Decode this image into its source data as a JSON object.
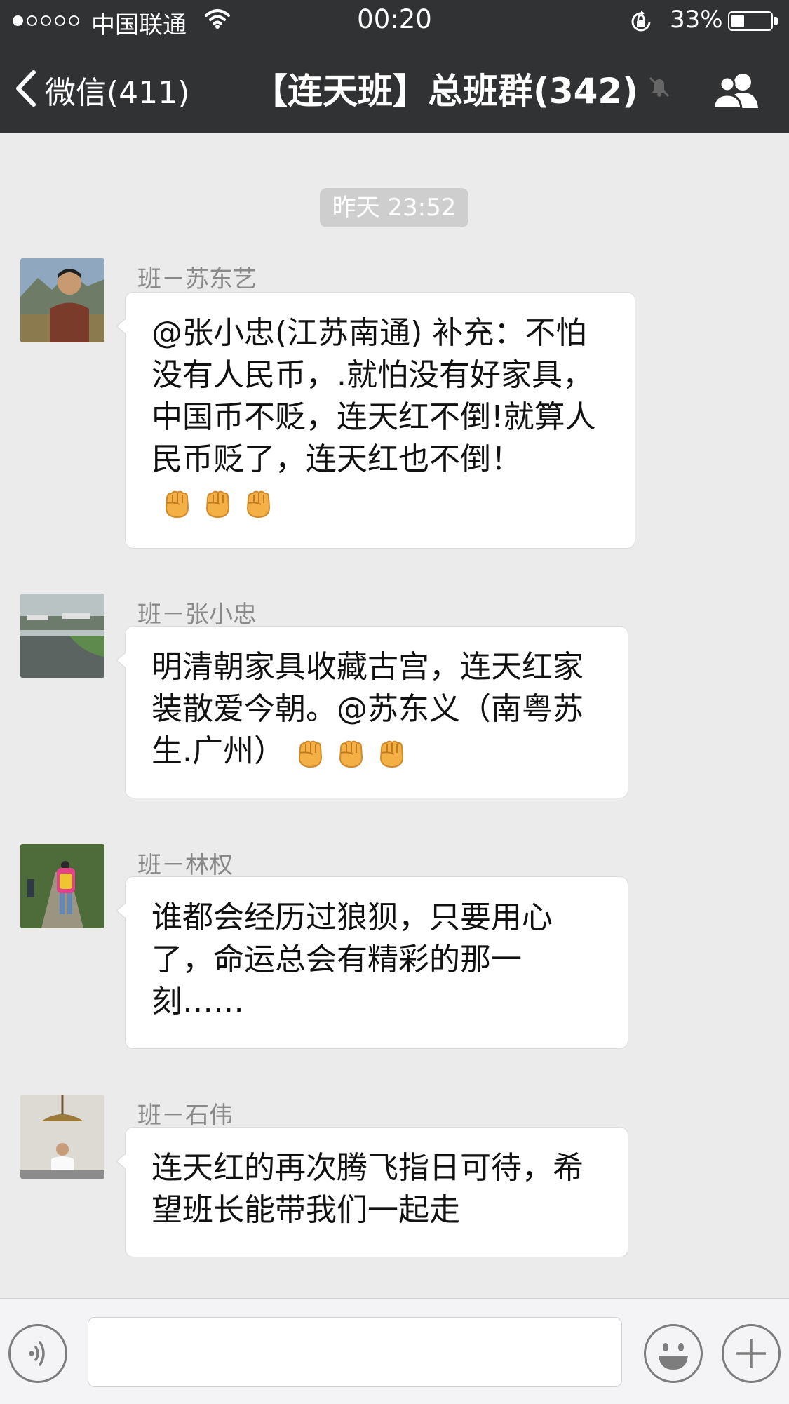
{
  "status_bar": {
    "carrier": "中国联通",
    "time": "00:20",
    "battery_percent": "33%",
    "battery_level": 0.33,
    "signal_strength": 1
  },
  "nav": {
    "back_label": "微信(411)",
    "title": "【连天班】总班群(342)"
  },
  "chat": {
    "timestamp": "昨天 23:52",
    "messages": [
      {
        "sender": "班－苏东艺",
        "text": "@张小忠(江苏南通) 补充：不怕没有人民币，.就怕没有好家具，中国币不贬，连天红不倒!就算人民币贬了，连天红也不倒！",
        "fists": 3
      },
      {
        "sender": "班－张小忠",
        "text": "明清朝家具收藏古宫，连天红家装散爱今朝。@苏东义（南粤苏生.广州）",
        "fists": 3
      },
      {
        "sender": "班－林权",
        "text": "谁都会经历过狼狈，只要用心了，命运总会有精彩的那一刻……",
        "fists": 0
      },
      {
        "sender": "班－石伟",
        "text": "连天红的再次腾飞指日可待，希望班长能带我们一起走",
        "fists": 0
      }
    ]
  },
  "input_bar": {
    "text_value": ""
  },
  "icons": {
    "back": "chevron-left-icon",
    "mute": "bell-muted-icon",
    "group": "group-members-icon",
    "voice": "voice-icon",
    "emoji": "emoji-icon",
    "more": "plus-icon",
    "fist": "fist-emoji-icon"
  },
  "colors": {
    "nav_bg": "#303234",
    "chat_bg": "#ebebeb",
    "bubble_bg": "#ffffff"
  }
}
